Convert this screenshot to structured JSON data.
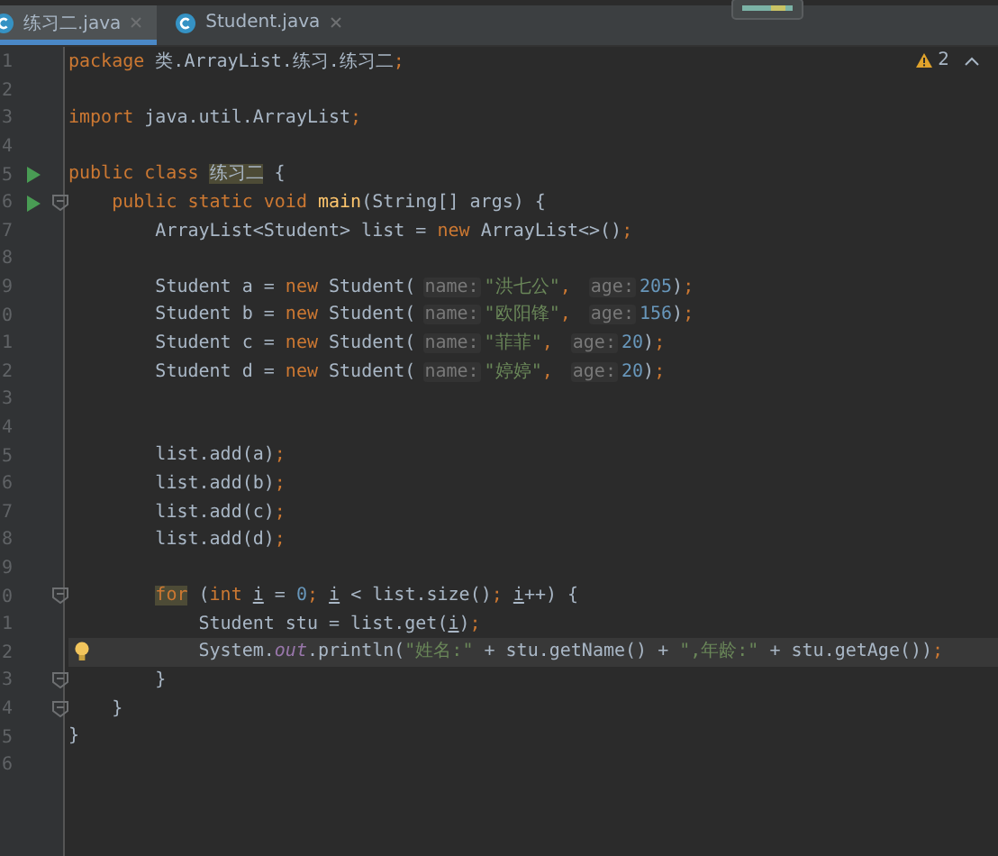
{
  "tabs": [
    {
      "label": "练习二.java",
      "selected": true
    },
    {
      "label": "Student.java",
      "selected": false
    }
  ],
  "inspection": {
    "count": "2"
  },
  "lines": [
    {
      "number": "1",
      "current": false,
      "tokens": [
        {
          "kind": "kw",
          "text": "package "
        },
        {
          "kind": "text",
          "text": "类.ArrayList.练习.练习二"
        },
        {
          "kind": "punct",
          "text": ";"
        }
      ]
    },
    {
      "number": "2",
      "current": false
    },
    {
      "number": "3",
      "current": false,
      "tokens": [
        {
          "kind": "kw",
          "text": "import "
        },
        {
          "kind": "text",
          "text": "java.util.ArrayList"
        },
        {
          "kind": "punct",
          "text": ";"
        }
      ]
    },
    {
      "number": "4",
      "current": false
    },
    {
      "number": "5",
      "run": true,
      "current": false,
      "tokens": [
        {
          "kind": "kw",
          "text": "public class "
        },
        {
          "kind": "match",
          "text": "练习二"
        },
        {
          "kind": "text",
          "text": " {"
        }
      ]
    },
    {
      "number": "6",
      "run": true,
      "fold": true,
      "current": false,
      "tokens": [
        {
          "kind": "kw",
          "text": "    public static void "
        },
        {
          "kind": "fn",
          "text": "main"
        },
        {
          "kind": "text",
          "text": "(String[] args) {"
        }
      ]
    },
    {
      "number": "7",
      "current": false,
      "tokens": [
        {
          "kind": "text",
          "text": "        ArrayList<Student> list = "
        },
        {
          "kind": "kw",
          "text": "new "
        },
        {
          "kind": "text",
          "text": "ArrayList<>()"
        },
        {
          "kind": "punct",
          "text": ";"
        }
      ]
    },
    {
      "number": "8",
      "current": false
    },
    {
      "number": "9",
      "current": false,
      "tokens": [
        {
          "kind": "text",
          "text": "        Student a = "
        },
        {
          "kind": "kw",
          "text": "new "
        },
        {
          "kind": "text",
          "text": "Student("
        },
        {
          "kind": "hint",
          "text": "name:"
        },
        {
          "kind": "str",
          "text": "\"洪七公\""
        },
        {
          "kind": "punct",
          "text": ", "
        },
        {
          "kind": "hint",
          "text": "age:"
        },
        {
          "kind": "num",
          "text": "205"
        },
        {
          "kind": "text",
          "text": ")"
        },
        {
          "kind": "punct",
          "text": ";"
        }
      ]
    },
    {
      "number": "0",
      "current": false,
      "tokens": [
        {
          "kind": "text",
          "text": "        Student b = "
        },
        {
          "kind": "kw",
          "text": "new "
        },
        {
          "kind": "text",
          "text": "Student("
        },
        {
          "kind": "hint",
          "text": "name:"
        },
        {
          "kind": "str",
          "text": "\"欧阳锋\""
        },
        {
          "kind": "punct",
          "text": ", "
        },
        {
          "kind": "hint",
          "text": "age:"
        },
        {
          "kind": "num",
          "text": "156"
        },
        {
          "kind": "text",
          "text": ")"
        },
        {
          "kind": "punct",
          "text": ";"
        }
      ]
    },
    {
      "number": "1",
      "current": false,
      "tokens": [
        {
          "kind": "text",
          "text": "        Student c = "
        },
        {
          "kind": "kw",
          "text": "new "
        },
        {
          "kind": "text",
          "text": "Student("
        },
        {
          "kind": "hint",
          "text": "name:"
        },
        {
          "kind": "str",
          "text": "\"菲菲\""
        },
        {
          "kind": "punct",
          "text": ", "
        },
        {
          "kind": "hint",
          "text": "age:"
        },
        {
          "kind": "num",
          "text": "20"
        },
        {
          "kind": "text",
          "text": ")"
        },
        {
          "kind": "punct",
          "text": ";"
        }
      ]
    },
    {
      "number": "2",
      "current": false,
      "tokens": [
        {
          "kind": "text",
          "text": "        Student d = "
        },
        {
          "kind": "kw",
          "text": "new "
        },
        {
          "kind": "text",
          "text": "Student("
        },
        {
          "kind": "hint",
          "text": "name:"
        },
        {
          "kind": "str",
          "text": "\"婷婷\""
        },
        {
          "kind": "punct",
          "text": ", "
        },
        {
          "kind": "hint",
          "text": "age:"
        },
        {
          "kind": "num",
          "text": "20"
        },
        {
          "kind": "text",
          "text": ")"
        },
        {
          "kind": "punct",
          "text": ";"
        }
      ]
    },
    {
      "number": "3",
      "current": false
    },
    {
      "number": "4",
      "current": false
    },
    {
      "number": "5",
      "current": false,
      "tokens": [
        {
          "kind": "text",
          "text": "        list.add(a)"
        },
        {
          "kind": "punct",
          "text": ";"
        }
      ]
    },
    {
      "number": "6",
      "current": false,
      "tokens": [
        {
          "kind": "text",
          "text": "        list.add(b)"
        },
        {
          "kind": "punct",
          "text": ";"
        }
      ]
    },
    {
      "number": "7",
      "current": false,
      "tokens": [
        {
          "kind": "text",
          "text": "        list.add(c)"
        },
        {
          "kind": "punct",
          "text": ";"
        }
      ]
    },
    {
      "number": "8",
      "current": false,
      "tokens": [
        {
          "kind": "text",
          "text": "        list.add(d)"
        },
        {
          "kind": "punct",
          "text": ";"
        }
      ]
    },
    {
      "number": "9",
      "current": false
    },
    {
      "number": "0",
      "fold": true,
      "current": false,
      "tokens": [
        {
          "kind": "kwmatch",
          "text": "        for"
        },
        {
          "kind": "text",
          "text": " ("
        },
        {
          "kind": "kw",
          "text": "int "
        },
        {
          "kind": "var",
          "text": "i"
        },
        {
          "kind": "text",
          "text": " = "
        },
        {
          "kind": "num",
          "text": "0"
        },
        {
          "kind": "punct",
          "text": "; "
        },
        {
          "kind": "var",
          "text": "i"
        },
        {
          "kind": "text",
          "text": " < list.size()"
        },
        {
          "kind": "punct",
          "text": "; "
        },
        {
          "kind": "var",
          "text": "i"
        },
        {
          "kind": "text",
          "text": "++) {"
        }
      ]
    },
    {
      "number": "1",
      "current": false,
      "tokens": [
        {
          "kind": "text",
          "text": "            Student stu = list.get("
        },
        {
          "kind": "var",
          "text": "i"
        },
        {
          "kind": "text",
          "text": ")"
        },
        {
          "kind": "punct",
          "text": ";"
        }
      ]
    },
    {
      "number": "2",
      "bulb": true,
      "current": true,
      "tokens": [
        {
          "kind": "text",
          "text": "            System."
        },
        {
          "kind": "field",
          "text": "out"
        },
        {
          "kind": "text",
          "text": ".println("
        },
        {
          "kind": "str",
          "text": "\"姓名:\""
        },
        {
          "kind": "text",
          "text": " + stu.getName() + "
        },
        {
          "kind": "str",
          "text": "\",年龄:\""
        },
        {
          "kind": "text",
          "text": " + stu.getAge())"
        },
        {
          "kind": "punct",
          "text": ";"
        }
      ]
    },
    {
      "number": "3",
      "fold": true,
      "current": false,
      "tokens": [
        {
          "kind": "text",
          "text": "        }"
        }
      ]
    },
    {
      "number": "4",
      "fold": true,
      "current": false,
      "tokens": [
        {
          "kind": "text",
          "text": "    }"
        }
      ]
    },
    {
      "number": "5",
      "current": false,
      "tokens": [
        {
          "kind": "text",
          "text": "}"
        }
      ]
    },
    {
      "number": "6",
      "current": false
    }
  ]
}
